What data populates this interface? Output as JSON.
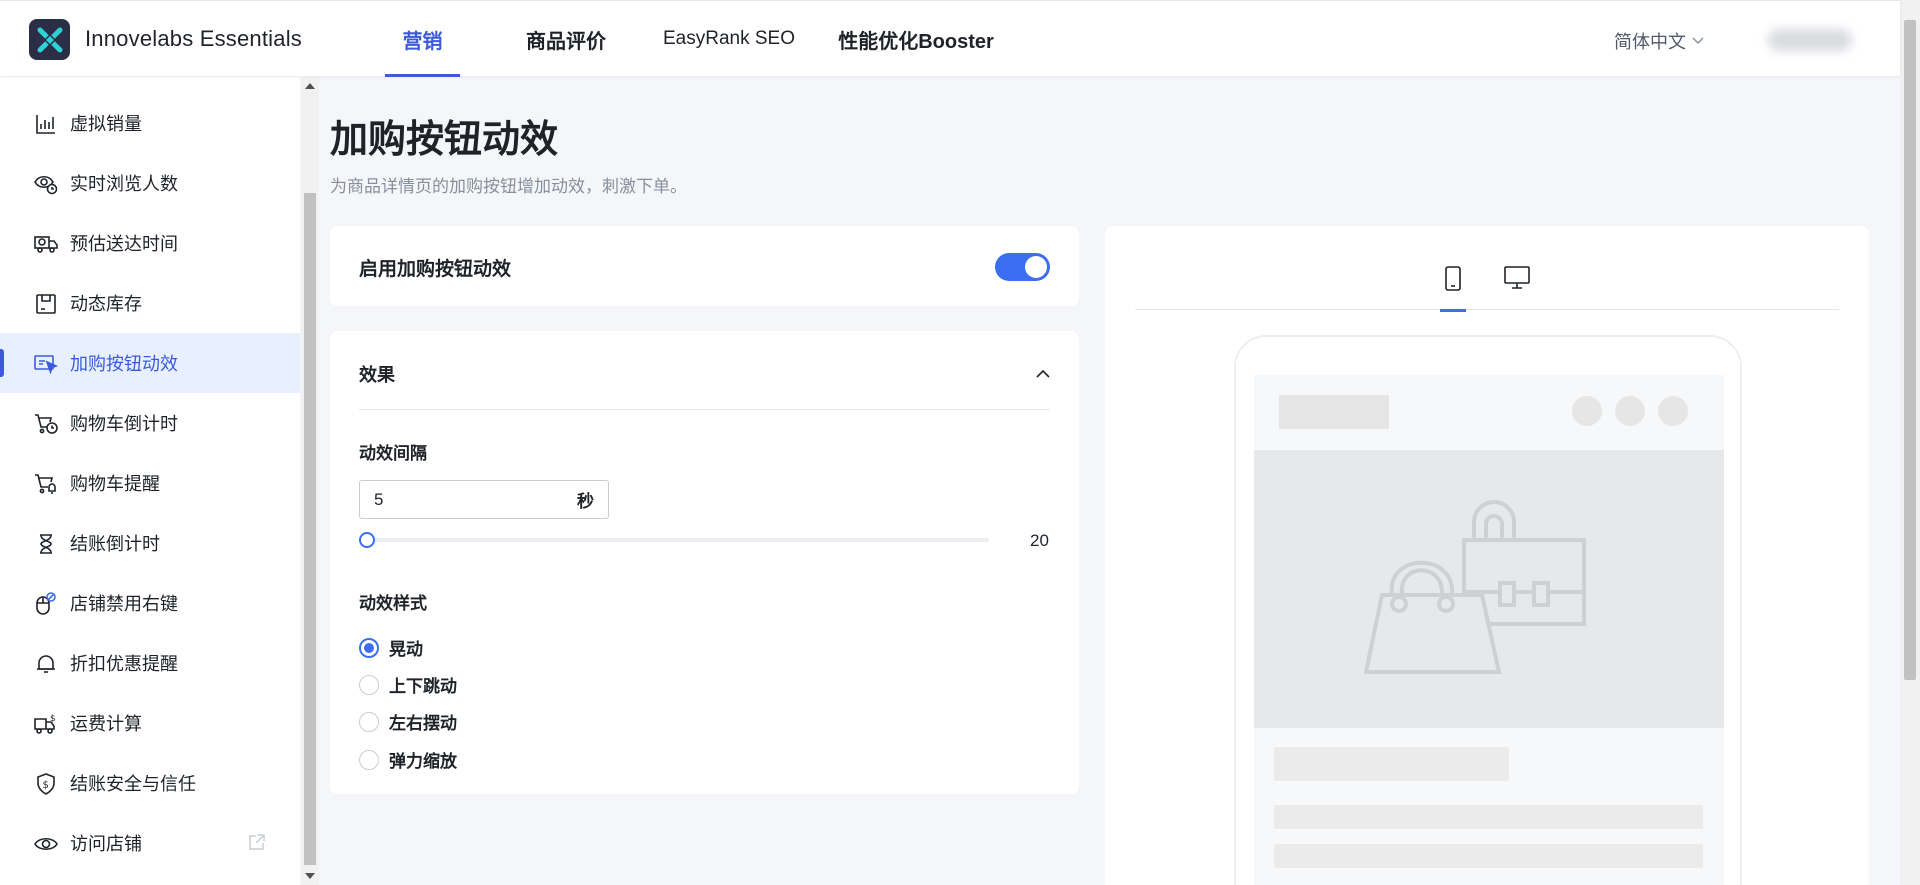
{
  "app": {
    "title": "Innovelabs Essentials",
    "logo_icon": "x-logo-icon",
    "accent": "#3b5bdb"
  },
  "nav": {
    "tabs": [
      {
        "label": "营销",
        "active": true
      },
      {
        "label": "商品评价"
      },
      {
        "label": "EasyRank SEO"
      },
      {
        "label": "性能优化Booster"
      }
    ]
  },
  "header": {
    "language": "简体中文"
  },
  "sidebar": {
    "items": [
      {
        "label": "虚拟销量",
        "icon": "bar-chart-icon"
      },
      {
        "label": "实时浏览人数",
        "icon": "eye-clock-icon"
      },
      {
        "label": "预估送达时间",
        "icon": "truck-clock-icon"
      },
      {
        "label": "动态库存",
        "icon": "inventory-box-icon"
      },
      {
        "label": "加购按钮动效",
        "icon": "cursor-button-icon",
        "active": true
      },
      {
        "label": "购物车倒计时",
        "icon": "cart-clock-icon"
      },
      {
        "label": "购物车提醒",
        "icon": "cart-bell-icon"
      },
      {
        "label": "结账倒计时",
        "icon": "hourglass-icon"
      },
      {
        "label": "店铺禁用右键",
        "icon": "mouse-block-icon"
      },
      {
        "label": "折扣优惠提醒",
        "icon": "bell-icon"
      },
      {
        "label": "运费计算",
        "icon": "truck-dollar-icon"
      },
      {
        "label": "结账安全与信任",
        "icon": "shield-dollar-icon"
      },
      {
        "label": "访问店铺",
        "icon": "eye-icon",
        "external": true
      }
    ]
  },
  "main": {
    "title": "加购按钮动效",
    "subtitle": "为商品详情页的加购按钮增加动效，刺激下单。",
    "enable": {
      "label": "启用加购按钮动效",
      "on": true
    },
    "effect": {
      "title": "效果",
      "interval_label": "动效间隔",
      "interval_value": "5",
      "interval_unit": "秒",
      "slider_max": "20",
      "slider_fraction": 0,
      "style_label": "动效样式",
      "styles": [
        {
          "label": "晃动",
          "checked": true
        },
        {
          "label": "上下跳动",
          "checked": false
        },
        {
          "label": "左右摆动",
          "checked": false
        },
        {
          "label": "弹力缩放",
          "checked": false
        }
      ]
    }
  }
}
